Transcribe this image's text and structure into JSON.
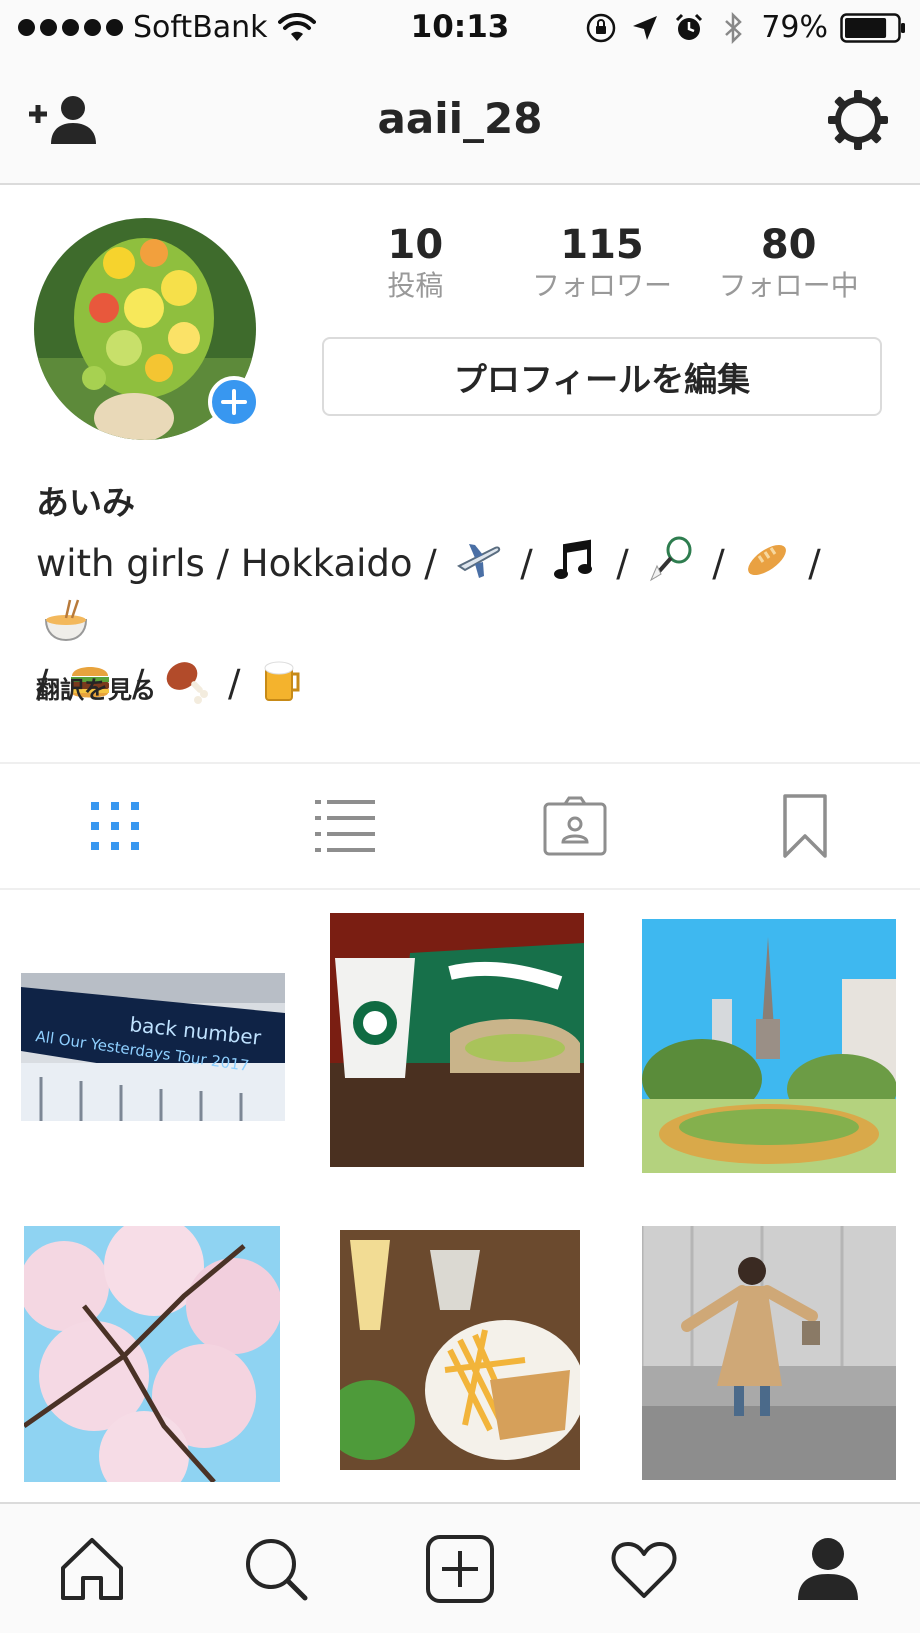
{
  "status_bar": {
    "carrier": "SoftBank",
    "time": "10:13",
    "battery_percent": "79%",
    "battery_level": 0.79
  },
  "nav": {
    "title": "aaii_28",
    "icons": [
      "add-user-icon",
      "gear-icon"
    ]
  },
  "profile": {
    "stats": [
      {
        "value": "10",
        "label": "投稿"
      },
      {
        "value": "115",
        "label": "フォロワー"
      },
      {
        "value": "80",
        "label": "フォロー中"
      }
    ],
    "edit_button": "プロフィールを編集",
    "display_name": "あいみ",
    "bio_line1": "with girls / Hokkaido /",
    "bio_separator": "/",
    "bio_emojis_line1": [
      "airplane",
      "music-notes",
      "badminton",
      "bread",
      "ramen"
    ],
    "bio_emojis_line2": [
      "hamburger",
      "meat-on-bone",
      "beer-mug"
    ],
    "translate_link": "翻訳を見る"
  },
  "tabs": [
    {
      "name": "grid-view",
      "active": true
    },
    {
      "name": "list-view",
      "active": false
    },
    {
      "name": "tagged",
      "active": false
    },
    {
      "name": "saved",
      "active": false
    }
  ],
  "grid": {
    "photos": [
      {
        "subject": "back number concert sign",
        "caption_text": "back number",
        "caption_text2": "All Our Yesterdays Tour 2017"
      },
      {
        "subject": "Starbucks drink and sandwich"
      },
      {
        "subject": "Sapporo TV tower and park"
      },
      {
        "subject": "cherry blossoms"
      },
      {
        "subject": "drinks, fries and sandwich"
      },
      {
        "subject": "woman in trench coat"
      }
    ]
  },
  "bottom_bar": {
    "items": [
      "home-icon",
      "search-icon",
      "new-post-icon",
      "activity-icon",
      "profile-icon"
    ]
  },
  "colors": {
    "accent": "#3897f0",
    "text": "#262626",
    "secondary_text": "#999999",
    "border": "#dbdbdb"
  }
}
